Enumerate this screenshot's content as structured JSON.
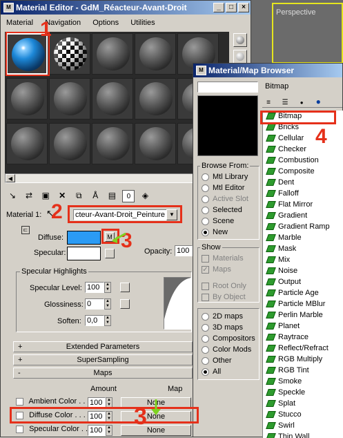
{
  "material_editor": {
    "title": "Material Editor - GdM_Réacteur-Avant-Droit",
    "menu": [
      "Material",
      "Navigation",
      "Options",
      "Utilities"
    ],
    "material_label": "Material 1:",
    "material_name": "cteur-Avant-Droit_Peinture",
    "diffuse_label": "Diffuse:",
    "specular_label": "Specular:",
    "diffuse_map_button": "M",
    "opacity_label": "Opacity:",
    "opacity_value": "100",
    "specular_highlights": {
      "title": "Specular Highlights",
      "level_label": "Specular Level:",
      "level_value": "100",
      "gloss_label": "Glossiness:",
      "gloss_value": "0",
      "soften_label": "Soften:",
      "soften_value": "0,0"
    },
    "rollouts": {
      "extended": "Extended Parameters",
      "supersampling": "SuperSampling",
      "maps": "Maps",
      "plus": "+",
      "minus": "-"
    },
    "maps": {
      "amount_header": "Amount",
      "map_header": "Map",
      "rows": [
        {
          "label": "Ambient Color . . .",
          "amount": "100",
          "map": "None"
        },
        {
          "label": "Diffuse Color . . . .",
          "amount": "100",
          "map": "None"
        },
        {
          "label": "Specular Color . . .",
          "amount": "100",
          "map": "None"
        }
      ]
    },
    "colors": {
      "diffuse": "#2b9bf4",
      "specular": "#ffffff"
    }
  },
  "viewport": {
    "label": "Perspective",
    "border_color": "#e6e61e"
  },
  "browser": {
    "title": "Material/Map Browser",
    "search_value": "",
    "current_label": "Bitmap",
    "browse_from_title": "Browse From:",
    "browse_from": [
      {
        "label": "Mtl Library",
        "selected": false,
        "enabled": true
      },
      {
        "label": "Mtl Editor",
        "selected": false,
        "enabled": true
      },
      {
        "label": "Active Slot",
        "selected": false,
        "enabled": false
      },
      {
        "label": "Selected",
        "selected": false,
        "enabled": true
      },
      {
        "label": "Scene",
        "selected": false,
        "enabled": true
      },
      {
        "label": "New",
        "selected": true,
        "enabled": true
      }
    ],
    "show_title": "Show",
    "show": [
      {
        "label": "Materials",
        "checked": false
      },
      {
        "label": "Maps",
        "checked": true
      }
    ],
    "root": [
      {
        "label": "Root Only"
      },
      {
        "label": "By Object"
      }
    ],
    "filters": [
      {
        "label": "2D maps",
        "selected": false
      },
      {
        "label": "3D maps",
        "selected": false
      },
      {
        "label": "Compositors",
        "selected": false
      },
      {
        "label": "Color Mods",
        "selected": false
      },
      {
        "label": "Other",
        "selected": false
      },
      {
        "label": "All",
        "selected": true
      }
    ],
    "map_list": [
      "Bitmap",
      "Bricks",
      "Cellular",
      "Checker",
      "Combustion",
      "Composite",
      "Dent",
      "Falloff",
      "Flat Mirror",
      "Gradient",
      "Gradient Ramp",
      "Marble",
      "Mask",
      "Mix",
      "Noise",
      "Output",
      "Particle Age",
      "Particle MBlur",
      "Perlin Marble",
      "Planet",
      "Raytrace",
      "Reflect/Refract",
      "RGB Multiply",
      "RGB Tint",
      "Smoke",
      "Speckle",
      "Splat",
      "Stucco",
      "Swirl",
      "Thin Wall Refraction"
    ]
  },
  "annotations": {
    "n1": "1",
    "n2": "2",
    "n3a": "3",
    "n3b": "3",
    "n4": "4",
    "accent": "#e5301a"
  }
}
